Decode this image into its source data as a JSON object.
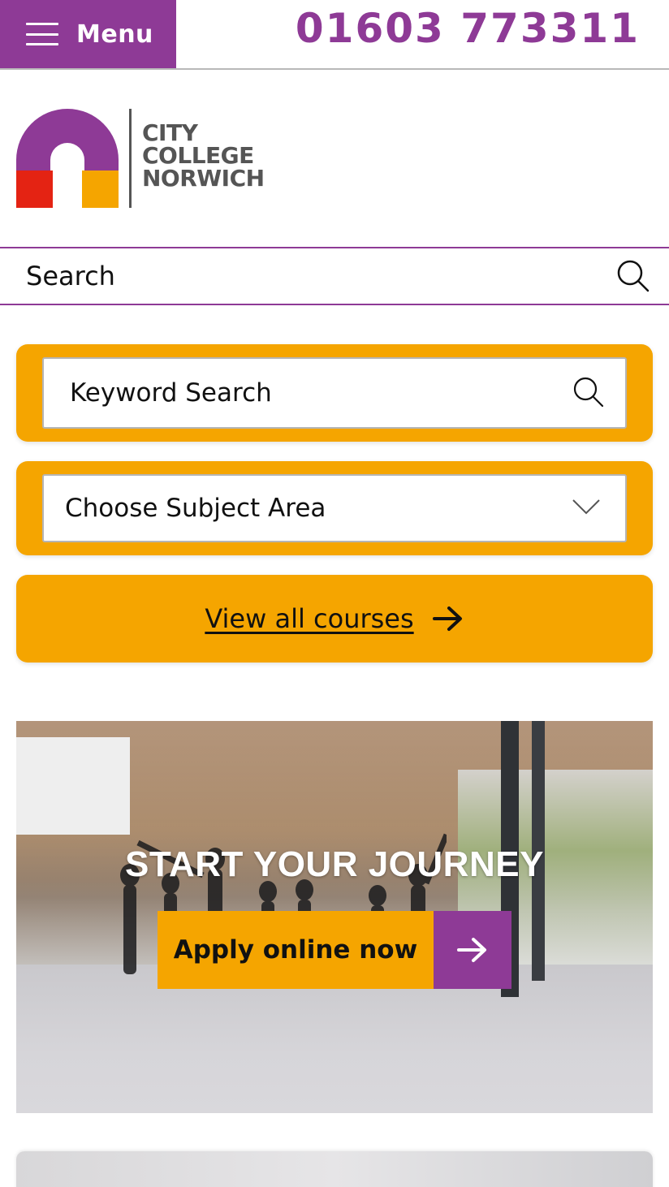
{
  "header": {
    "menu_label": "Menu",
    "phone": "01603 773311"
  },
  "logo": {
    "line1": "CITY",
    "line2": "COLLEGE",
    "line3": "NORWICH"
  },
  "site_search": {
    "label": "Search"
  },
  "course_search": {
    "keyword_placeholder": "Keyword Search",
    "subject_selected": "Choose Subject Area",
    "view_all_label": "View all courses"
  },
  "hero": {
    "title": "START YOUR JOURNEY",
    "apply_label": "Apply online now"
  },
  "colors": {
    "brand_purple": "#8e3a96",
    "brand_orange": "#f5a500",
    "logo_red": "#e42313",
    "logo_grey": "#555555"
  },
  "icons": {
    "menu": "hamburger-icon",
    "site_search": "search-icon",
    "keyword_search": "search-icon",
    "subject_dropdown": "chevron-down-icon",
    "view_all": "arrow-right-icon",
    "apply": "arrow-right-icon"
  }
}
